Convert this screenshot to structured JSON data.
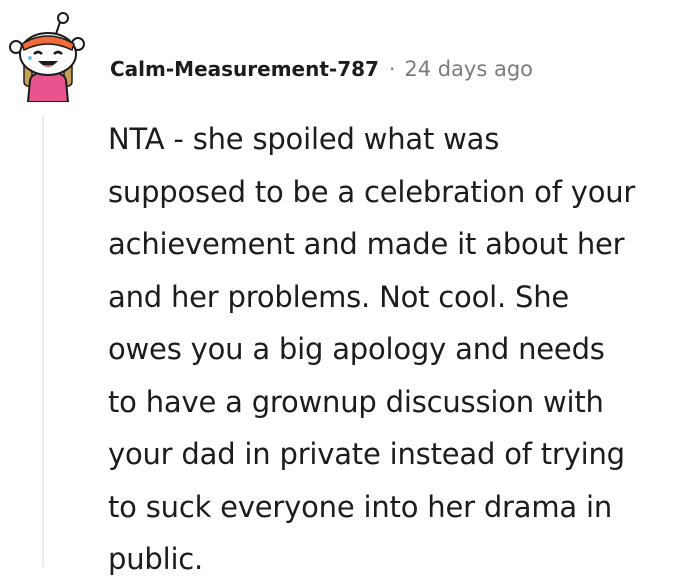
{
  "comment": {
    "author": "Calm-Measurement-787",
    "separator": "·",
    "timestamp": "24 days ago",
    "body_lines": [
      "NTA - she spoiled what was",
      "supposed to be a celebration of your",
      "achievement and made it about her",
      "and her problems. Not cool. She",
      "owes you a big apology and needs",
      "to have a grownup discussion with",
      "your dad in private instead of trying",
      "to suck everyone into her drama in",
      "public."
    ]
  },
  "avatar": {
    "icon": "snoo-avatar-icon",
    "colors": {
      "face": "#ffffff",
      "hair": "#f26b3a",
      "shirt": "#e8548e",
      "outline": "#1c1c1c"
    }
  }
}
